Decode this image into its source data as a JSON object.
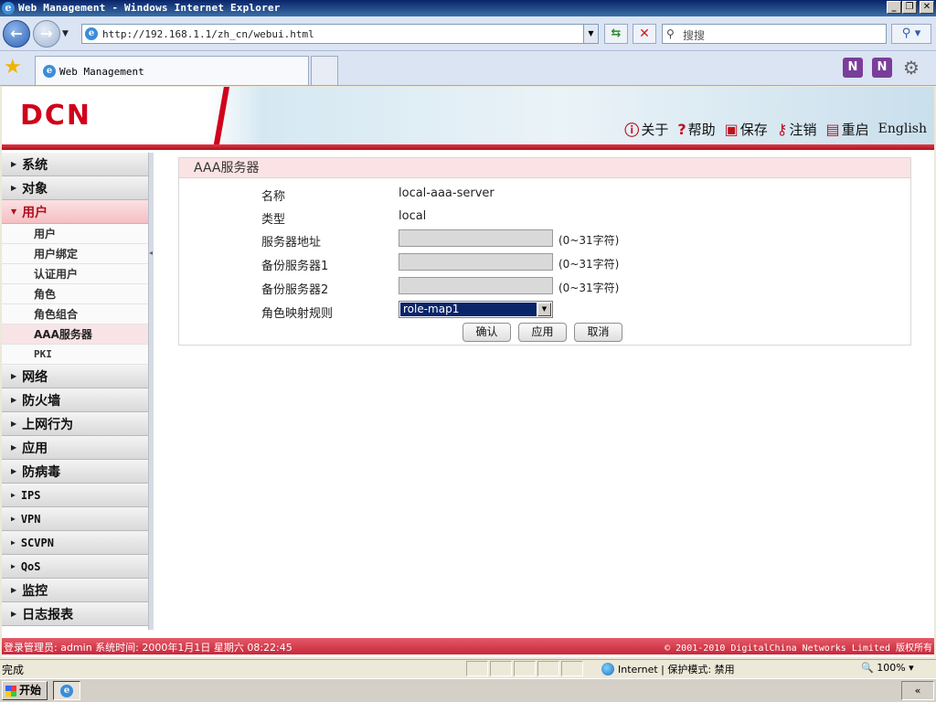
{
  "window": {
    "title": "Web Management - Windows Internet Explorer"
  },
  "browser": {
    "url": "http://192.168.1.1/zh_cn/webui.html",
    "search_placeholder": "搜搜",
    "tab_title": "Web Management"
  },
  "header": {
    "logo": "DCN",
    "links": [
      {
        "label": "关于",
        "icon": "info-icon"
      },
      {
        "label": "帮助",
        "icon": "help-icon"
      },
      {
        "label": "保存",
        "icon": "save-icon"
      },
      {
        "label": "注销",
        "icon": "logout-icon"
      },
      {
        "label": "重启",
        "icon": "restart-icon"
      }
    ],
    "english": "English"
  },
  "sidebar": {
    "top_items": [
      "系统",
      "对象"
    ],
    "open_item": "用户",
    "sub_items": [
      "用户",
      "用户绑定",
      "认证用户",
      "角色",
      "角色组合",
      "AAA服务器",
      "PKI"
    ],
    "active_sub": "AAA服务器",
    "bottom_items": [
      "网络",
      "防火墙",
      "上网行为",
      "应用",
      "防病毒",
      "IPS",
      "VPN",
      "SCVPN",
      "QoS",
      "监控",
      "日志报表"
    ]
  },
  "form": {
    "title": "AAA服务器",
    "name_label": "名称",
    "name_value": "local-aaa-server",
    "type_label": "类型",
    "type_value": "local",
    "server_label": "服务器地址",
    "server_value": "",
    "backup1_label": "备份服务器1",
    "backup1_value": "",
    "backup2_label": "备份服务器2",
    "backup2_value": "",
    "hint": "(0~31字符)",
    "role_map_label": "角色映射规则",
    "role_map_value": "role-map1",
    "confirm": "确认",
    "apply": "应用",
    "cancel": "取消"
  },
  "footer": {
    "left": "登录管理员: admin 系统时间: 2000年1月1日 星期六 08:22:45",
    "right": "© 2001-2010 DigitalChina Networks Limited 版权所有"
  },
  "statusbar": {
    "status": "完成",
    "zone": "Internet | 保护模式: 禁用",
    "zoom": "100%"
  },
  "taskbar": {
    "start": "开始"
  }
}
